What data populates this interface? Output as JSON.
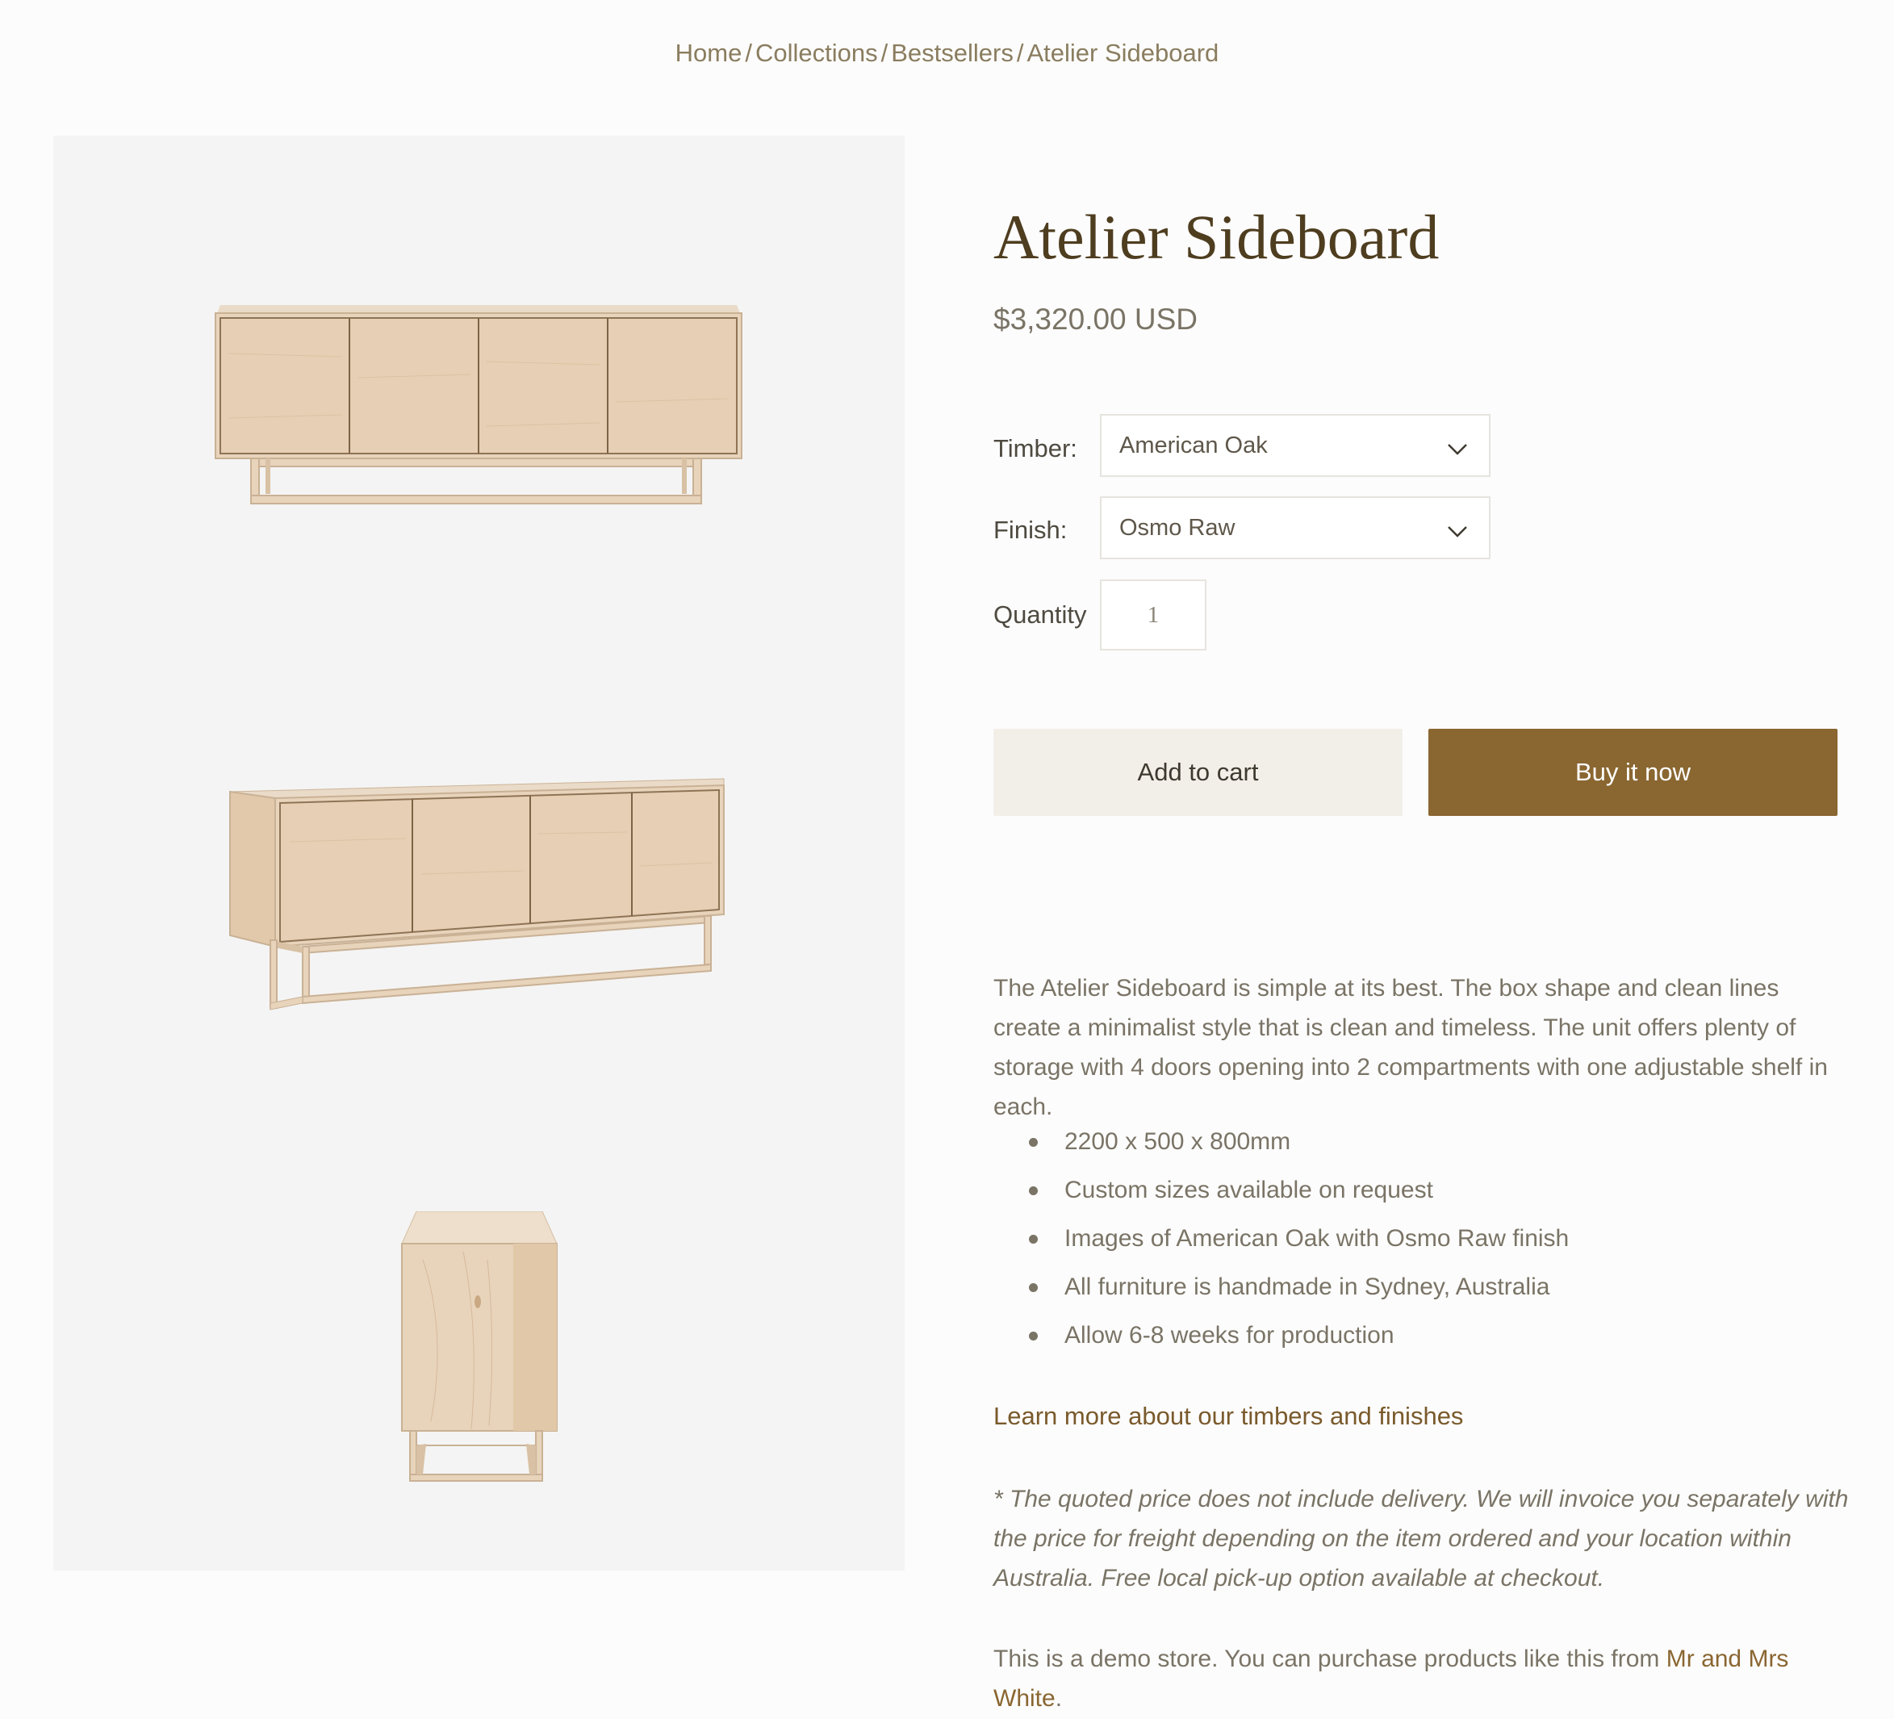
{
  "breadcrumb": {
    "items": [
      "Home",
      "Collections",
      "Bestsellers",
      "Atelier Sideboard"
    ],
    "separator": "/"
  },
  "product": {
    "title": "Atelier Sideboard",
    "price": "$3,320.00 USD"
  },
  "options": {
    "timber_label": "Timber:",
    "timber_value": "American Oak",
    "finish_label": "Finish:",
    "finish_value": "Osmo Raw",
    "quantity_label": "Quantity",
    "quantity_value": "1"
  },
  "actions": {
    "add_to_cart": "Add to cart",
    "buy_now": "Buy it now"
  },
  "description": {
    "intro": "The Atelier Sideboard is simple at its best. The box shape and clean lines create a minimalist style that is clean and timeless. The unit offers plenty of storage with 4 doors opening into 2 compartments with one adjustable shelf in each.",
    "bullets": [
      "2200 x 500 x 800mm",
      "Custom sizes available on request",
      "Images of American Oak with Osmo Raw finish",
      "All furniture is handmade in Sydney, Australia",
      "Allow 6-8 weeks for production"
    ],
    "learn_more": "Learn more about our timbers and finishes",
    "note": "* The quoted price does not include delivery. We will invoice you separately with the price for freight depending on the item ordered and your location within Australia. Free local pick-up option available at checkout.",
    "demo_text": "This is a demo store. You can purchase products like this from ",
    "demo_link": "Mr and Mrs White",
    "demo_end": "."
  },
  "icons": {
    "dropdown": "chevron-down-icon"
  },
  "colors": {
    "accent": "#8a6631",
    "title": "#4e3d1f",
    "cart_bg": "#f2efe8",
    "gallery_bg": "#f4f4f4",
    "wood": "#e8d3bb"
  }
}
